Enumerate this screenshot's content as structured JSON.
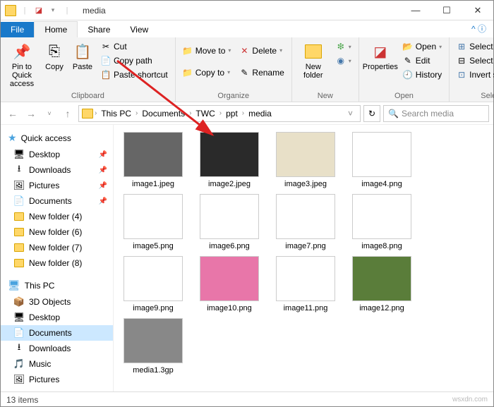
{
  "window": {
    "title": "media"
  },
  "tabs": {
    "file": "File",
    "home": "Home",
    "share": "Share",
    "view": "View"
  },
  "ribbon": {
    "clipboard": {
      "pin": "Pin to Quick access",
      "copy": "Copy",
      "paste": "Paste",
      "cut": "Cut",
      "copypath": "Copy path",
      "pasteshortcut": "Paste shortcut",
      "label": "Clipboard"
    },
    "organize": {
      "moveto": "Move to",
      "copyto": "Copy to",
      "delete": "Delete",
      "rename": "Rename",
      "label": "Organize"
    },
    "new": {
      "newfolder": "New folder",
      "label": "New"
    },
    "open": {
      "properties": "Properties",
      "open": "Open",
      "edit": "Edit",
      "history": "History",
      "label": "Open"
    },
    "select": {
      "selectall": "Select all",
      "selectnone": "Select none",
      "invert": "Invert selection",
      "label": "Select"
    }
  },
  "breadcrumbs": [
    "This PC",
    "Documents",
    "TWC",
    "ppt",
    "media"
  ],
  "search": {
    "placeholder": "Search media"
  },
  "sidebar": {
    "quickaccess": "Quick access",
    "qa_items": [
      {
        "label": "Desktop",
        "icon": "🖥"
      },
      {
        "label": "Downloads",
        "icon": "⭳"
      },
      {
        "label": "Pictures",
        "icon": "🖼"
      },
      {
        "label": "Documents",
        "icon": "📄"
      },
      {
        "label": "New folder (4)",
        "icon": "folder"
      },
      {
        "label": "New folder (6)",
        "icon": "folder"
      },
      {
        "label": "New folder (7)",
        "icon": "folder"
      },
      {
        "label": "New folder (8)",
        "icon": "folder"
      }
    ],
    "thispc": "This PC",
    "pc_items": [
      {
        "label": "3D Objects",
        "icon": "📦"
      },
      {
        "label": "Desktop",
        "icon": "🖥"
      },
      {
        "label": "Documents",
        "icon": "📄",
        "selected": true
      },
      {
        "label": "Downloads",
        "icon": "⭳"
      },
      {
        "label": "Music",
        "icon": "🎵"
      },
      {
        "label": "Pictures",
        "icon": "🖼"
      }
    ]
  },
  "files": [
    {
      "name": "image1.jpeg",
      "bg": "#666"
    },
    {
      "name": "image2.jpeg",
      "bg": "#2a2a2a"
    },
    {
      "name": "image3.jpeg",
      "bg": "#e8e0c8"
    },
    {
      "name": "image4.png",
      "bg": "#fff"
    },
    {
      "name": "image5.png",
      "bg": "#fff"
    },
    {
      "name": "image6.png",
      "bg": "#fff"
    },
    {
      "name": "image7.png",
      "bg": "#fff"
    },
    {
      "name": "image8.png",
      "bg": "#fff"
    },
    {
      "name": "image9.png",
      "bg": "#fff"
    },
    {
      "name": "image10.png",
      "bg": "#e876a9"
    },
    {
      "name": "image11.png",
      "bg": "#fff"
    },
    {
      "name": "image12.png",
      "bg": "#5a7d3a"
    },
    {
      "name": "media1.3gp",
      "bg": "#888"
    }
  ],
  "status": {
    "count": "13 items"
  },
  "watermark": "wsxdn.com"
}
